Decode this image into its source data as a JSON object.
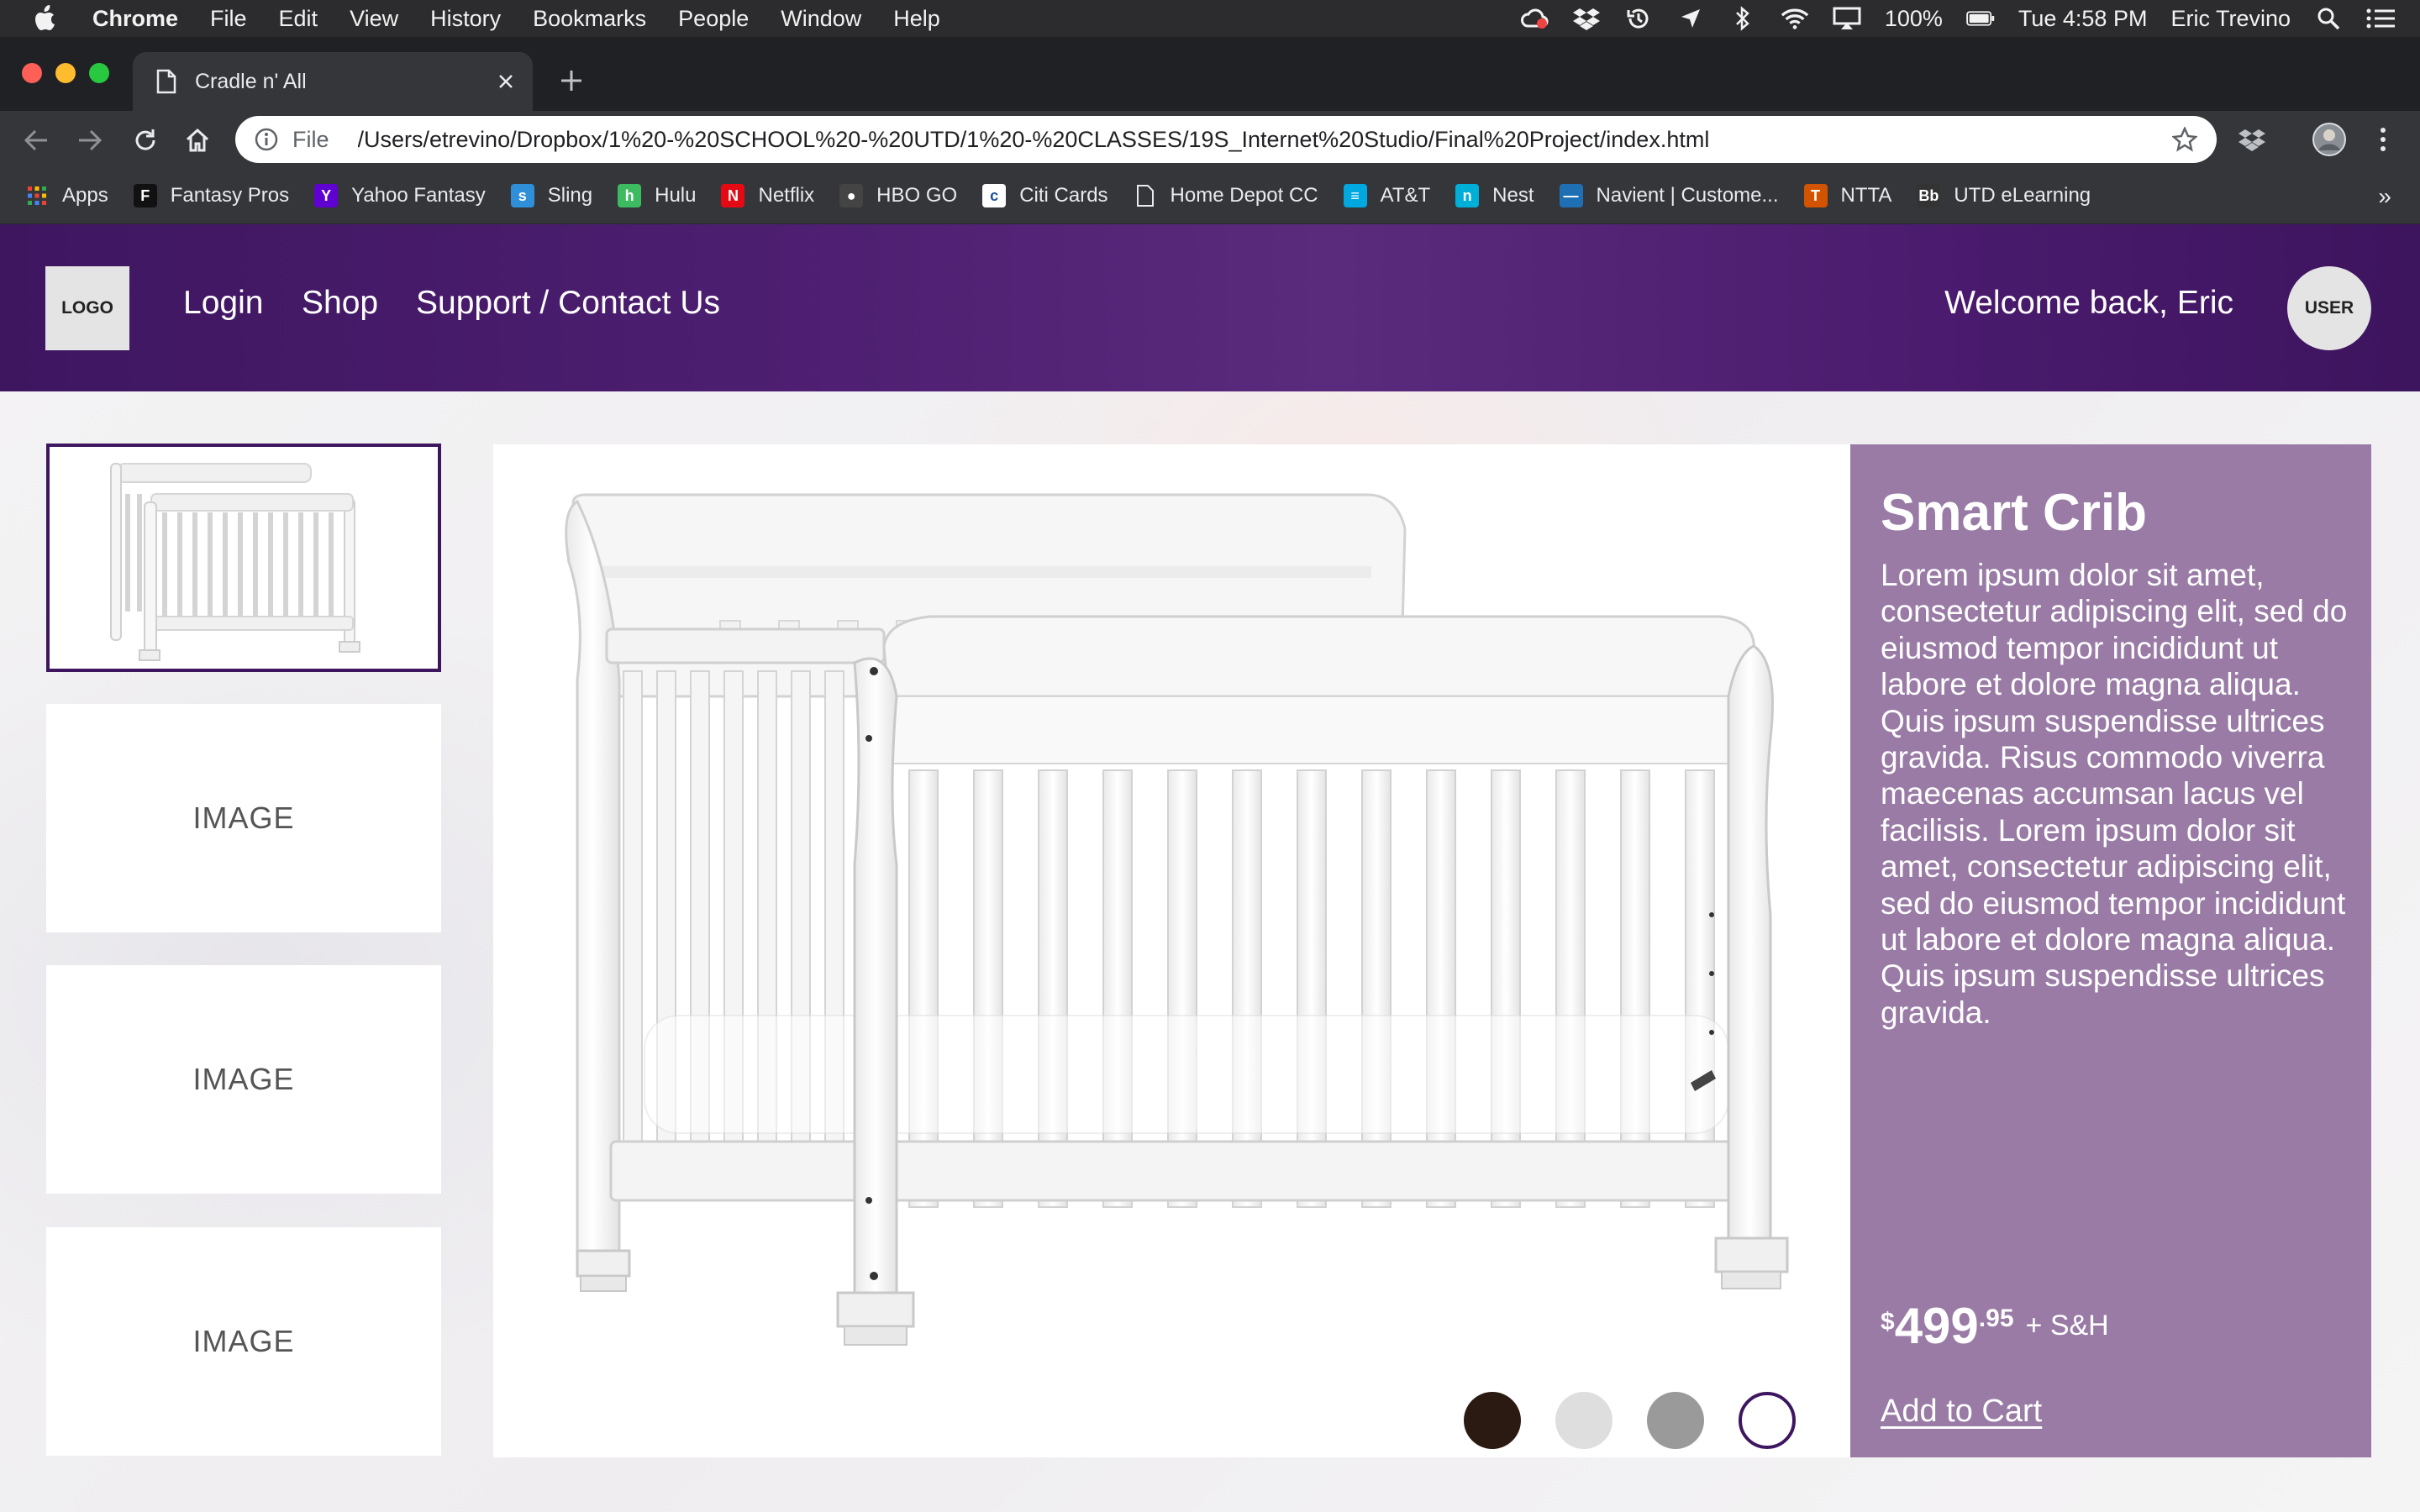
{
  "menubar": {
    "app": "Chrome",
    "items": [
      "File",
      "Edit",
      "View",
      "History",
      "Bookmarks",
      "People",
      "Window",
      "Help"
    ],
    "battery": "100%",
    "clock": "Tue 4:58 PM",
    "user": "Eric Trevino"
  },
  "browser": {
    "tab_title": "Cradle n' All",
    "scheme": "File",
    "url": "/Users/etrevino/Dropbox/1%20-%20SCHOOL%20-%20UTD/1%20-%20CLASSES/19S_Internet%20Studio/Final%20Project/index.html"
  },
  "bookmarks": [
    {
      "label": "Apps",
      "icon": "apps-grid-icon",
      "color": "#e8453c"
    },
    {
      "label": "Fantasy Pros",
      "icon": "fantasy-pros-icon",
      "color": "#111111",
      "glyph": "F"
    },
    {
      "label": "Yahoo Fantasy",
      "icon": "yahoo-icon",
      "color": "#5f01d1",
      "glyph": "Y"
    },
    {
      "label": "Sling",
      "icon": "sling-icon",
      "color": "#2f8fd8",
      "glyph": "s"
    },
    {
      "label": "Hulu",
      "icon": "hulu-icon",
      "color": "#3dbb61",
      "glyph": "h"
    },
    {
      "label": "Netflix",
      "icon": "netflix-icon",
      "color": "#e50914",
      "glyph": "N"
    },
    {
      "label": "HBO GO",
      "icon": "hbo-icon",
      "color": "#444444",
      "glyph": "●"
    },
    {
      "label": "Citi Cards",
      "icon": "citi-icon",
      "color": "#ffffff",
      "glyph": "c"
    },
    {
      "label": "Home Depot CC",
      "icon": "page-icon",
      "color": "#35363a",
      "glyph": ""
    },
    {
      "label": "AT&T",
      "icon": "att-icon",
      "color": "#00a8e0",
      "glyph": "≡"
    },
    {
      "label": "Nest",
      "icon": "nest-icon",
      "color": "#00afd8",
      "glyph": "n"
    },
    {
      "label": "Navient | Custome...",
      "icon": "navient-icon",
      "color": "#1f6fb5",
      "glyph": "—"
    },
    {
      "label": "NTTA",
      "icon": "ntta-icon",
      "color": "#d35400",
      "glyph": "T"
    },
    {
      "label": "UTD eLearning",
      "icon": "blackboard-icon",
      "color": "#333333",
      "glyph": "Bb"
    }
  ],
  "site": {
    "logo": "LOGO",
    "nav": [
      "Login",
      "Shop",
      "Support / Contact Us"
    ],
    "welcome": "Welcome back, Eric",
    "user_avatar": "USER"
  },
  "thumbnails": [
    "IMAGE",
    "IMAGE",
    "IMAGE"
  ],
  "swatches": [
    "#2b1a12",
    "#dedede",
    "#9a9a9a",
    "#ffffff"
  ],
  "product": {
    "title": "Smart Crib",
    "description": "Lorem ipsum dolor sit amet, consectetur adipiscing elit, sed do eiusmod tempor incididunt ut labore et dolore magna aliqua. Quis ipsum suspendisse ultrices gravida. Risus commodo viverra maecenas accumsan lacus vel facilisis. Lorem ipsum dolor sit amet, consectetur adipiscing elit, sed do eiusmod tempor incididunt ut labore et dolore magna aliqua. Quis ipsum suspendisse ultrices gravida.",
    "price_currency": "$",
    "price_dollars": "499",
    "price_cents": ".95",
    "shipping": "+ S&H",
    "add_to_cart": "Add to Cart"
  },
  "colors": {
    "header": "#4a1b6e",
    "panel": "#997ba6",
    "selected_border": "#3e1660"
  }
}
